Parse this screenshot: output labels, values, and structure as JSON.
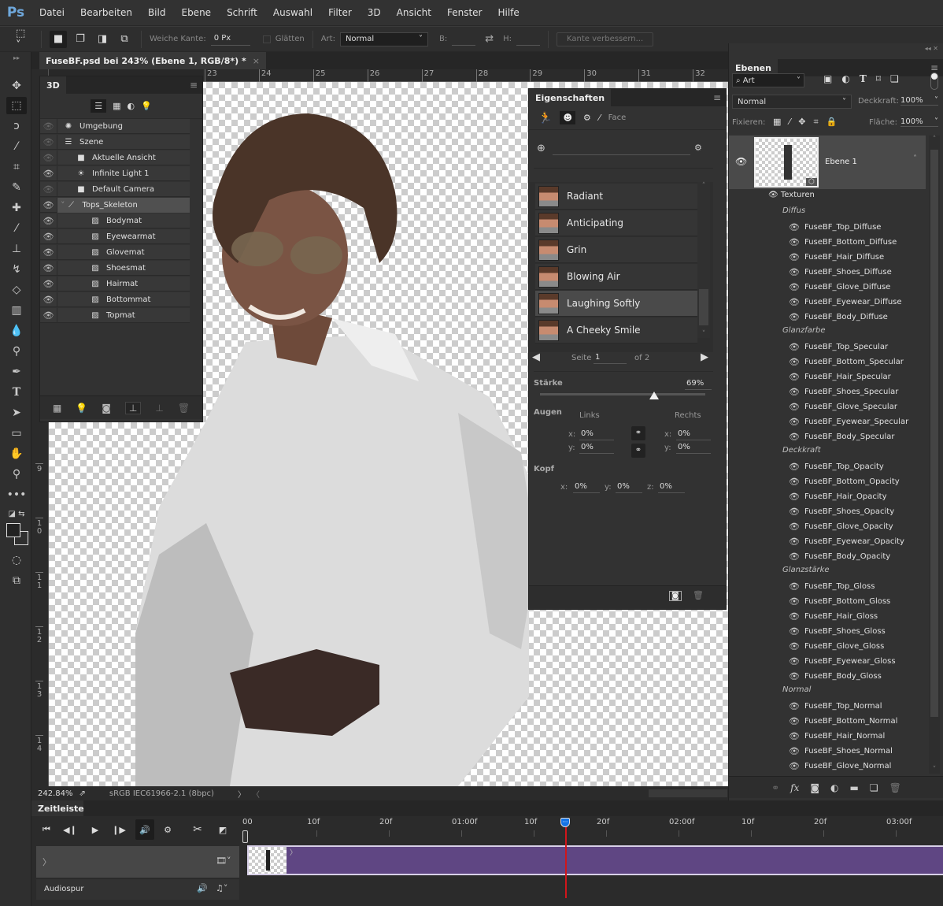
{
  "app": {
    "logo": "Ps"
  },
  "menu": [
    "Datei",
    "Bearbeiten",
    "Bild",
    "Ebene",
    "Schrift",
    "Auswahl",
    "Filter",
    "3D",
    "Ansicht",
    "Fenster",
    "Hilfe"
  ],
  "options": {
    "feather_label": "Weiche Kante:",
    "feather_value": "0 Px",
    "antialias_label": "Glätten",
    "style_label": "Art:",
    "style_value": "Normal",
    "width_label": "B:",
    "height_label": "H:",
    "refine_edge": "Kante verbessern..."
  },
  "document": {
    "tab_title": "FuseBF.psd bei 243% (Ebene 1, RGB/8*) *",
    "close": "×"
  },
  "ruler": {
    "h": [
      "23",
      "24",
      "25",
      "26",
      "27",
      "28",
      "29",
      "30",
      "31",
      "32"
    ],
    "v": [
      "9",
      "1\n0",
      "1\n1",
      "1\n2",
      "1\n3",
      "1\n4"
    ]
  },
  "panel3d": {
    "title": "3D",
    "items": [
      {
        "label": "Umgebung",
        "icon": "environment-icon",
        "visible": false,
        "level": 0
      },
      {
        "label": "Szene",
        "icon": "scene-icon",
        "visible": false,
        "level": 0
      },
      {
        "label": "Aktuelle Ansicht",
        "icon": "camera-icon",
        "visible": false,
        "level": 1
      },
      {
        "label": "Infinite Light 1",
        "icon": "light-icon",
        "visible": true,
        "level": 1
      },
      {
        "label": "Default Camera",
        "icon": "camera-icon",
        "visible": false,
        "level": 1
      },
      {
        "label": "Tops_Skeleton",
        "icon": "bone-icon",
        "visible": true,
        "level": 1,
        "selected": true
      },
      {
        "label": "Bodymat",
        "icon": "material-icon",
        "visible": true,
        "level": 2
      },
      {
        "label": "Eyewearmat",
        "icon": "material-icon",
        "visible": true,
        "level": 2
      },
      {
        "label": "Glovemat",
        "icon": "material-icon",
        "visible": true,
        "level": 2
      },
      {
        "label": "Shoesmat",
        "icon": "material-icon",
        "visible": true,
        "level": 2
      },
      {
        "label": "Hairmat",
        "icon": "material-icon",
        "visible": true,
        "level": 2
      },
      {
        "label": "Bottommat",
        "icon": "material-icon",
        "visible": true,
        "level": 2
      },
      {
        "label": "Topmat",
        "icon": "material-icon",
        "visible": true,
        "level": 2
      }
    ]
  },
  "properties": {
    "title": "Eigenschaften",
    "mode_label": "Face",
    "search_placeholder": "",
    "expressions": [
      "Radiant",
      "Anticipating",
      "Grin",
      "Blowing Air",
      "Laughing Softly",
      "A Cheeky Smile"
    ],
    "selected_expression": "Laughing Softly",
    "page_label": "Seite",
    "page_value": "1",
    "page_of": "of 2",
    "strength_label": "Stärke",
    "strength_value": "69%",
    "strength_fraction": 0.69,
    "eyes_label": "Augen",
    "left_label": "Links",
    "right_label": "Rechts",
    "eyes_left_x": "0%",
    "eyes_left_y": "0%",
    "eyes_right_x": "0%",
    "eyes_right_y": "0%",
    "head_label": "Kopf",
    "head_x": "0%",
    "head_y": "0%",
    "head_z": "0%",
    "x": "x:",
    "y": "y:",
    "z": "z:"
  },
  "layers": {
    "title": "Ebenen",
    "filter_value": "Art",
    "blend_mode": "Normal",
    "opacity_label": "Deckkraft:",
    "opacity_value": "100%",
    "lock_label": "Fixieren:",
    "fill_label": "Fläche:",
    "fill_value": "100%",
    "layer_name": "Ebene 1",
    "textures_label": "Texturen",
    "groups": [
      {
        "name": "Diffus",
        "items": [
          "FuseBF_Top_Diffuse",
          "FuseBF_Bottom_Diffuse",
          "FuseBF_Hair_Diffuse",
          "FuseBF_Shoes_Diffuse",
          "FuseBF_Glove_Diffuse",
          "FuseBF_Eyewear_Diffuse",
          "FuseBF_Body_Diffuse"
        ]
      },
      {
        "name": "Glanzfarbe",
        "items": [
          "FuseBF_Top_Specular",
          "FuseBF_Bottom_Specular",
          "FuseBF_Hair_Specular",
          "FuseBF_Shoes_Specular",
          "FuseBF_Glove_Specular",
          "FuseBF_Eyewear_Specular",
          "FuseBF_Body_Specular"
        ]
      },
      {
        "name": "Deckkraft",
        "items": [
          "FuseBF_Top_Opacity",
          "FuseBF_Bottom_Opacity",
          "FuseBF_Hair_Opacity",
          "FuseBF_Shoes_Opacity",
          "FuseBF_Glove_Opacity",
          "FuseBF_Eyewear_Opacity",
          "FuseBF_Body_Opacity"
        ]
      },
      {
        "name": "Glanzstärke",
        "items": [
          "FuseBF_Top_Gloss",
          "FuseBF_Bottom_Gloss",
          "FuseBF_Hair_Gloss",
          "FuseBF_Shoes_Gloss",
          "FuseBF_Glove_Gloss",
          "FuseBF_Eyewear_Gloss",
          "FuseBF_Body_Gloss"
        ]
      },
      {
        "name": "Normal",
        "items": [
          "FuseBF_Top_Normal",
          "FuseBF_Bottom_Normal",
          "FuseBF_Hair_Normal",
          "FuseBF_Shoes_Normal",
          "FuseBF_Glove_Normal"
        ]
      }
    ]
  },
  "status": {
    "zoom": "242.84%",
    "profile": "sRGB IEC61966-2.1 (8bpc)"
  },
  "timeline": {
    "title": "Zeitleiste",
    "ticks": [
      "00",
      "10f",
      "20f",
      "01:00f",
      "10f",
      "20f",
      "02:00f",
      "10f",
      "20f",
      "03:00f"
    ],
    "audio_track_label": "Audiospur",
    "clip_color": "#5f4683",
    "playhead_color": "#d0161b"
  },
  "colors": {
    "accent": "#1473e6",
    "clip": "#5f4683",
    "playhead": "#d0161b"
  }
}
